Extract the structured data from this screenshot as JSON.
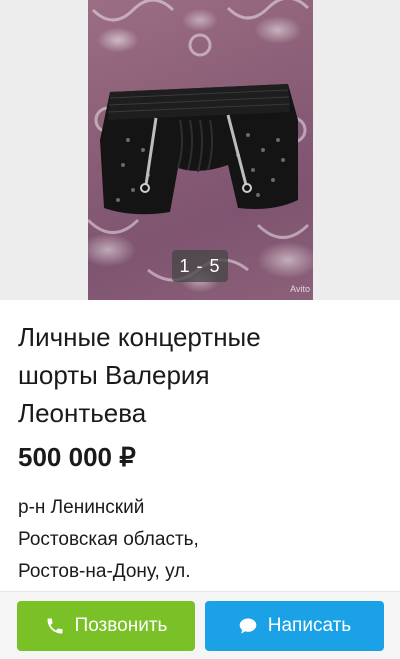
{
  "gallery": {
    "counter": "1 - 5",
    "watermark": "Avito"
  },
  "listing": {
    "title_lines": [
      "Личные концертные",
      "шорты Валерия",
      "Леонтьева"
    ],
    "price": "500 000 ₽",
    "location_lines": [
      "р-н Ленинский",
      "Ростовская область,",
      "Ростов-на-Дону, ул."
    ]
  },
  "actions": {
    "call_label": "Позвонить",
    "call_icon": "phone-icon",
    "write_label": "Написать",
    "write_icon": "chat-bubble-icon"
  },
  "colors": {
    "call_button": "#7ac128",
    "write_button": "#1ba2e6",
    "counter_bg": "#464646"
  }
}
